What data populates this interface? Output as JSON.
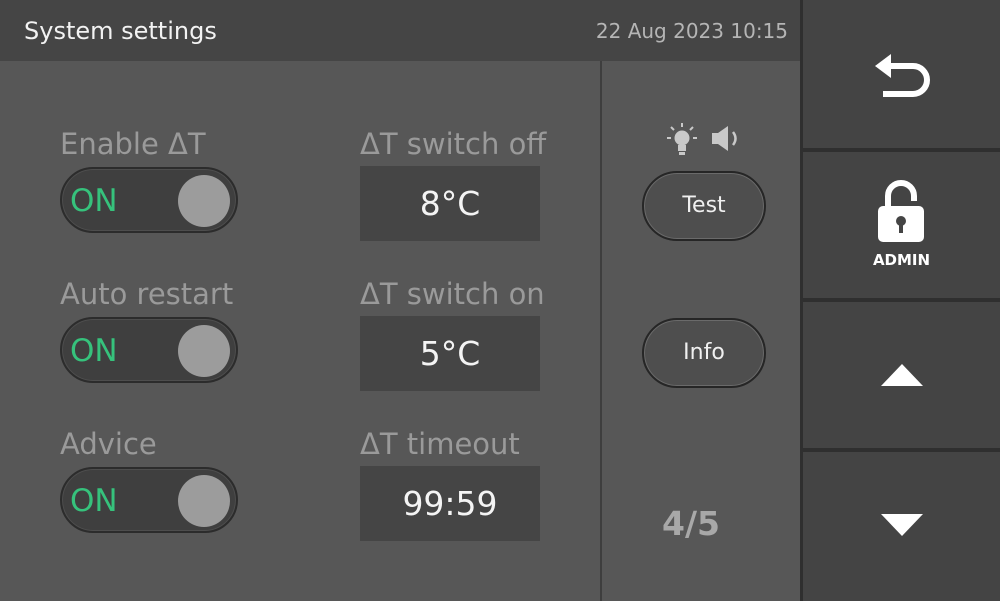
{
  "header": {
    "title": "System settings",
    "datetime": "22 Aug 2023 10:15"
  },
  "settings": [
    {
      "toggle_label": "Enable ΔT",
      "toggle_state": "ON",
      "field_label": "ΔT switch off",
      "field_value": "8°C"
    },
    {
      "toggle_label": "Auto restart",
      "toggle_state": "ON",
      "field_label": "ΔT switch on",
      "field_value": "5°C"
    },
    {
      "toggle_label": "Advice",
      "toggle_state": "ON",
      "field_label": "ΔT timeout",
      "field_value": "99:59"
    }
  ],
  "side": {
    "indicator_icons": [
      "light-bulb-icon",
      "speaker-icon"
    ],
    "test_label": "Test",
    "info_label": "Info",
    "page": "4/5"
  },
  "nav": {
    "back_icon": "back-arrow-icon",
    "lock_icon": "padlock-icon",
    "admin_label": "ADMIN",
    "up_icon": "up-arrow-icon",
    "down_icon": "down-arrow-icon"
  },
  "colors": {
    "on_state": "#36c27c",
    "panel": "#575757",
    "header": "#454545",
    "nav_button": "#444444"
  }
}
